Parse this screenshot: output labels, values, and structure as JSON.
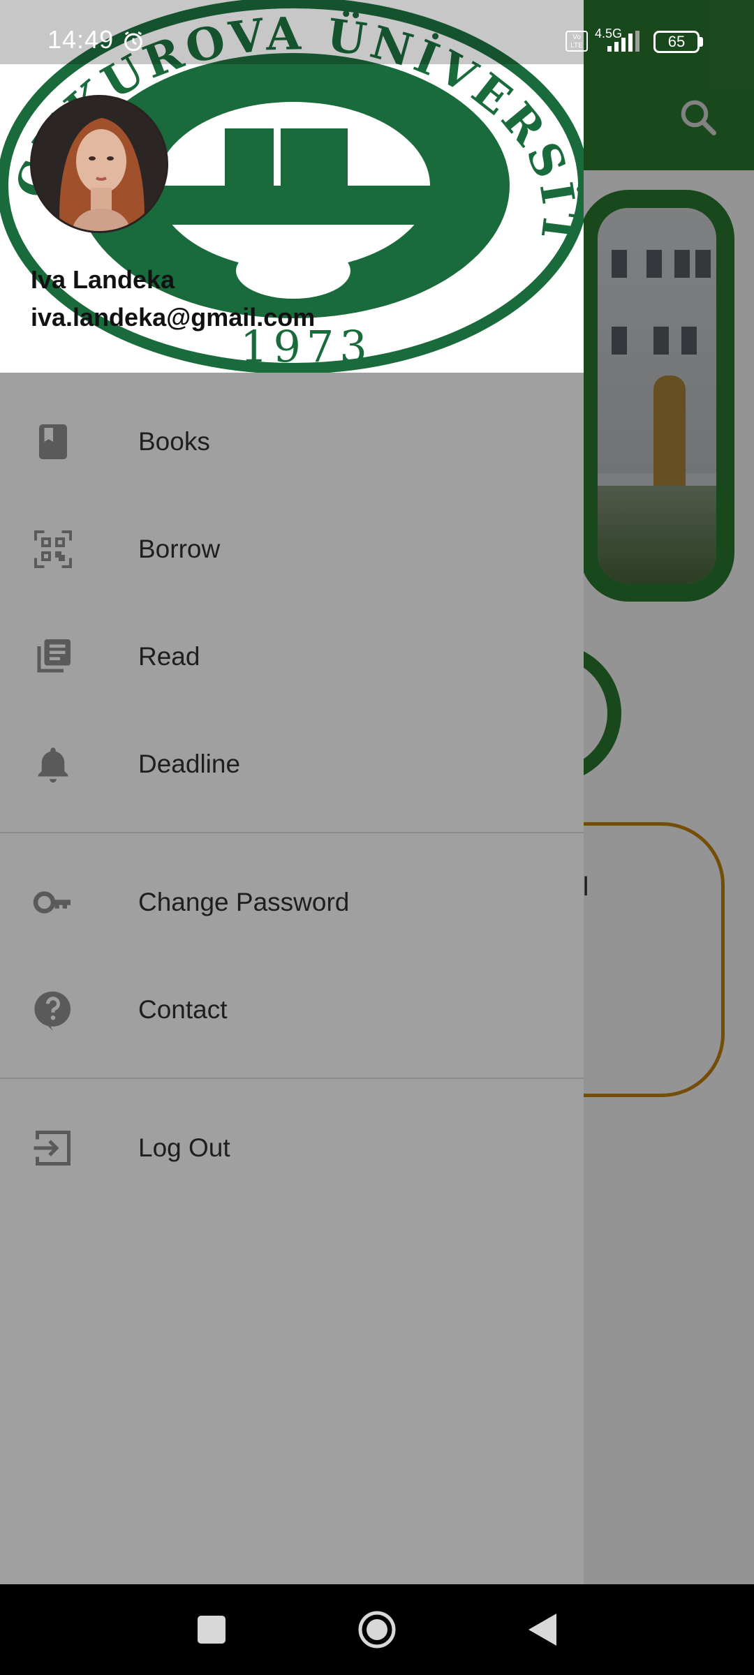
{
  "status_bar": {
    "time": "14:49",
    "network": "4.5G",
    "volte": "Vo LTE",
    "battery": "65",
    "icons": [
      "alarm-icon",
      "signal-icon",
      "battery-icon"
    ]
  },
  "background": {
    "app_bar_color": "#2e7d32",
    "card_text": "ill",
    "card_border_color": "#c8860c",
    "icons": [
      "search-icon"
    ]
  },
  "drawer": {
    "header": {
      "name": "Iva Landeka",
      "email": "iva.landeka@gmail.com",
      "logo_text": "ÇUKUROVA ÜNİVERSİTESİ",
      "logo_year": "1973",
      "logo_color": "#1a6b3c"
    },
    "sections": [
      {
        "items": [
          {
            "label": "Books",
            "icon": "book-icon"
          },
          {
            "label": "Borrow",
            "icon": "qr-scan-icon"
          },
          {
            "label": "Read",
            "icon": "library-books-icon"
          },
          {
            "label": "Deadline",
            "icon": "bell-icon"
          }
        ]
      },
      {
        "items": [
          {
            "label": "Change Password",
            "icon": "key-icon"
          },
          {
            "label": "Contact",
            "icon": "help-icon"
          }
        ]
      },
      {
        "items": [
          {
            "label": "Log Out",
            "icon": "logout-icon"
          }
        ]
      }
    ]
  },
  "nav_bar": {
    "buttons": [
      "recents",
      "home",
      "back"
    ]
  }
}
